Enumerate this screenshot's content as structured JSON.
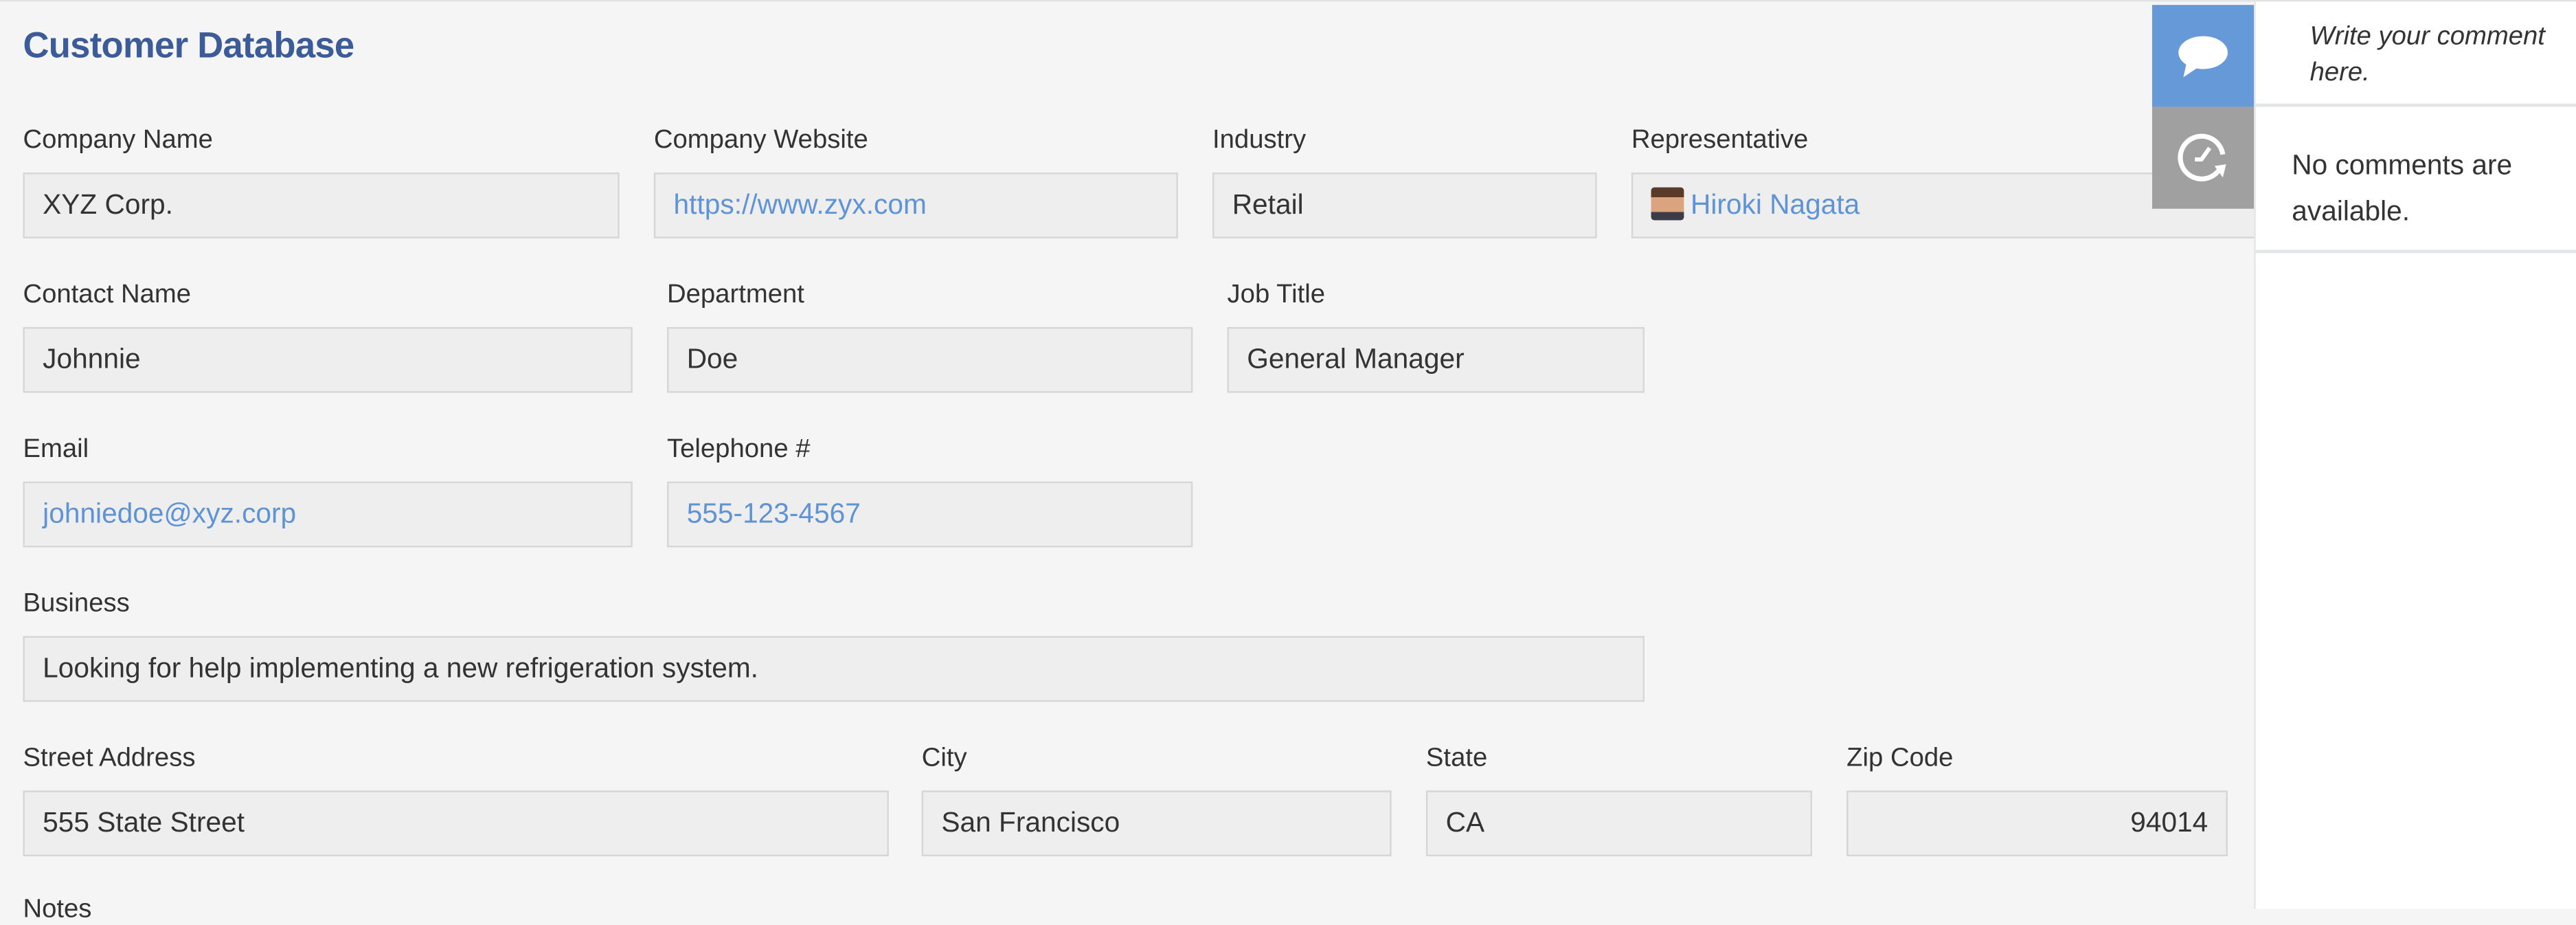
{
  "title": "Customer Database",
  "fields": {
    "company_name": {
      "label": "Company Name",
      "value": "XYZ Corp."
    },
    "company_website": {
      "label": "Company Website",
      "value": "https://www.zyx.com"
    },
    "industry": {
      "label": "Industry",
      "value": "Retail"
    },
    "representative": {
      "label": "Representative",
      "value": "Hiroki Nagata"
    },
    "contact_name": {
      "label": "Contact Name",
      "value": "Johnnie"
    },
    "department": {
      "label": "Department",
      "value": "Doe"
    },
    "job_title": {
      "label": "Job Title",
      "value": "General Manager"
    },
    "email": {
      "label": "Email",
      "value": "johniedoe@xyz.corp"
    },
    "telephone": {
      "label": "Telephone #",
      "value": "555-123-4567"
    },
    "business": {
      "label": "Business",
      "value": "Looking for help implementing a new refrigeration system."
    },
    "street": {
      "label": "Street Address",
      "value": "555 State Street"
    },
    "city": {
      "label": "City",
      "value": "San Francisco"
    },
    "state": {
      "label": "State",
      "value": "CA"
    },
    "zip": {
      "label": "Zip Code",
      "value": "94014"
    },
    "notes": {
      "label": "Notes"
    }
  },
  "sidebar": {
    "comment_placeholder": "Write your comment here.",
    "no_comments": "No comments are available.",
    "icons": [
      "comment-icon",
      "history-icon"
    ]
  },
  "colors": {
    "title": "#3b5b99",
    "link": "#5e93d6",
    "comment_tab": "#6699d8",
    "history_tab": "#a0a0a0"
  }
}
